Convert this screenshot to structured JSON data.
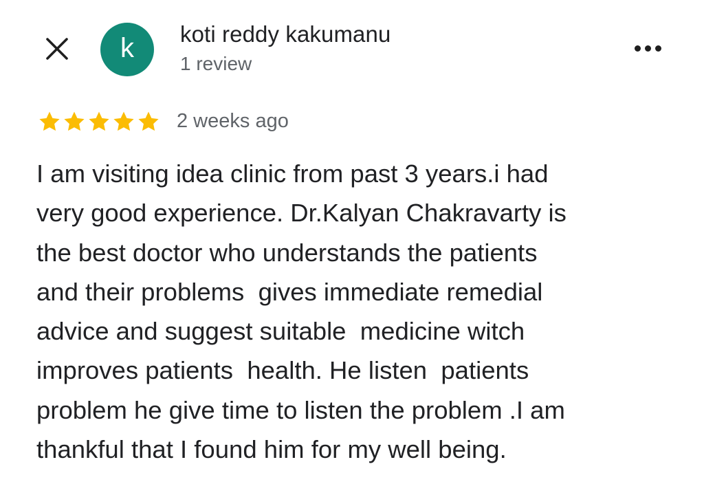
{
  "header": {
    "close_icon": "close-icon",
    "avatar_letter": "k",
    "avatar_color": "#128a77",
    "reviewer_name": "koti reddy kakumanu",
    "review_count": "1 review",
    "more_icon": "more-horizontal-icon"
  },
  "review": {
    "rating": 5,
    "rating_max": 5,
    "star_color": "#fbbc04",
    "date": "2 weeks ago",
    "lines": [
      "I am visiting idea clinic from past 3 years.i had",
      "very good experience. Dr.Kalyan Chakravarty is",
      "the best doctor who understands the patients",
      "and their problems  gives immediate remedial",
      "advice and suggest suitable  medicine witch",
      "improves patients  health. He listen  patients",
      "problem he give time to listen the problem .I am",
      "thankful that I found him for my well being."
    ]
  }
}
